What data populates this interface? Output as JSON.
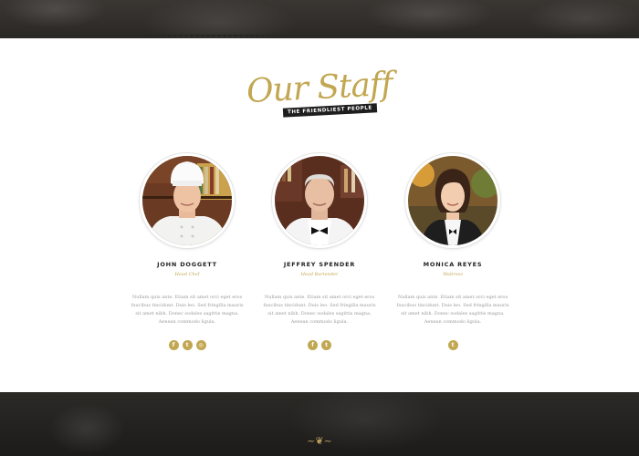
{
  "section": {
    "title": "Our Staff",
    "tagline": "THE FRIENDLIEST PEOPLE"
  },
  "staff": [
    {
      "name": "JOHN DOGGETT",
      "role": "Head Chef",
      "bio": "Nullam quis ante. Etiam sit amet orci eget eros faucibus tincidunt. Duis leo. Sed fringilla mauris sit amet nibh. Donec sodales sagittis magna. Aenean commodo ligula.",
      "socials": [
        "facebook-icon",
        "twitter-icon",
        "instagram-icon"
      ]
    },
    {
      "name": "JEFFREY SPENDER",
      "role": "Head Bartender",
      "bio": "Nullam quis ante. Etiam sit amet orci eget eros faucibus tincidunt. Duis leo. Sed fringilla mauris sit amet nibh. Donec sodales sagittis magna. Aenean commodo ligula.",
      "socials": [
        "facebook-icon",
        "twitter-icon"
      ]
    },
    {
      "name": "MONICA REYES",
      "role": "Waitress",
      "bio": "Nullam quis ante. Etiam sit amet orci eget eros faucibus tincidunt. Duis leo. Sed fringilla mauris sit amet nibh. Donec sodales sagittis magna. Aenean commodo ligula.",
      "socials": [
        "twitter-icon"
      ]
    }
  ],
  "colors": {
    "accent": "#c2a752",
    "dark": "#2a2825"
  }
}
